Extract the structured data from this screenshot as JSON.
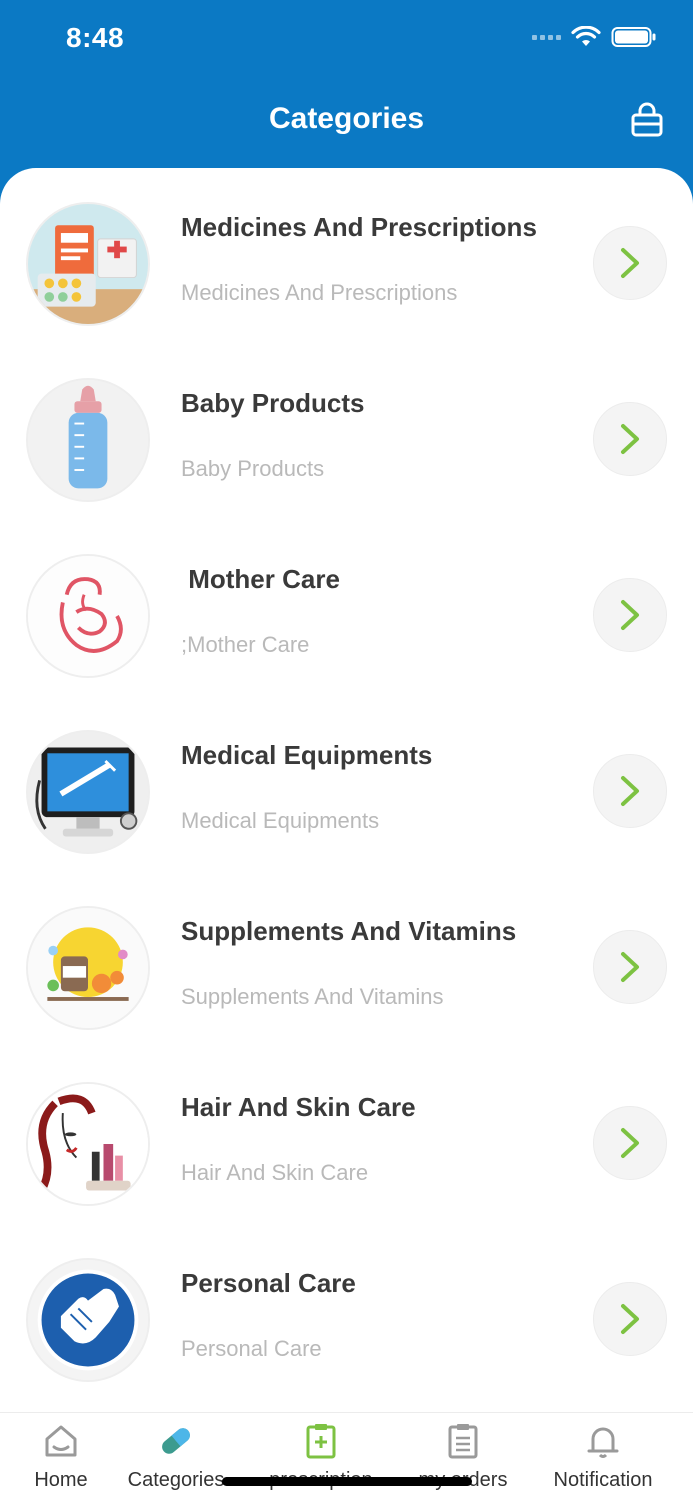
{
  "status_bar": {
    "time": "8:48"
  },
  "header": {
    "title": "Categories"
  },
  "categories": [
    {
      "title": "Medicines And Prescriptions",
      "subtitle": "Medicines And Prescriptions",
      "icon": "medicine-icon"
    },
    {
      "title": "Baby Products",
      "subtitle": "Baby Products",
      "icon": "baby-bottle-icon"
    },
    {
      "title": " Mother Care",
      "subtitle": ";Mother Care",
      "icon": "mother-baby-icon"
    },
    {
      "title": "Medical Equipments",
      "subtitle": "Medical Equipments",
      "icon": "medical-monitor-icon"
    },
    {
      "title": "Supplements And Vitamins",
      "subtitle": "Supplements And Vitamins",
      "icon": "vitamins-icon"
    },
    {
      "title": "Hair And Skin Care",
      "subtitle": "Hair And Skin Care",
      "icon": "cosmetics-icon"
    },
    {
      "title": "Personal Care",
      "subtitle": "Personal Care",
      "icon": "hand-wash-icon"
    }
  ],
  "tab_bar": {
    "items": [
      {
        "label": "Home",
        "icon": "home-icon"
      },
      {
        "label": "Categories",
        "icon": "pill-icon"
      },
      {
        "label": "prescription",
        "icon": "prescription-icon"
      },
      {
        "label": "my orders",
        "icon": "orders-icon"
      },
      {
        "label": "Notification",
        "icon": "bell-icon"
      }
    ]
  },
  "colors": {
    "primary": "#0b79c4",
    "accent": "#7dc242",
    "title_text": "#3a3a3a",
    "subtitle_text": "#b9b9b9"
  }
}
